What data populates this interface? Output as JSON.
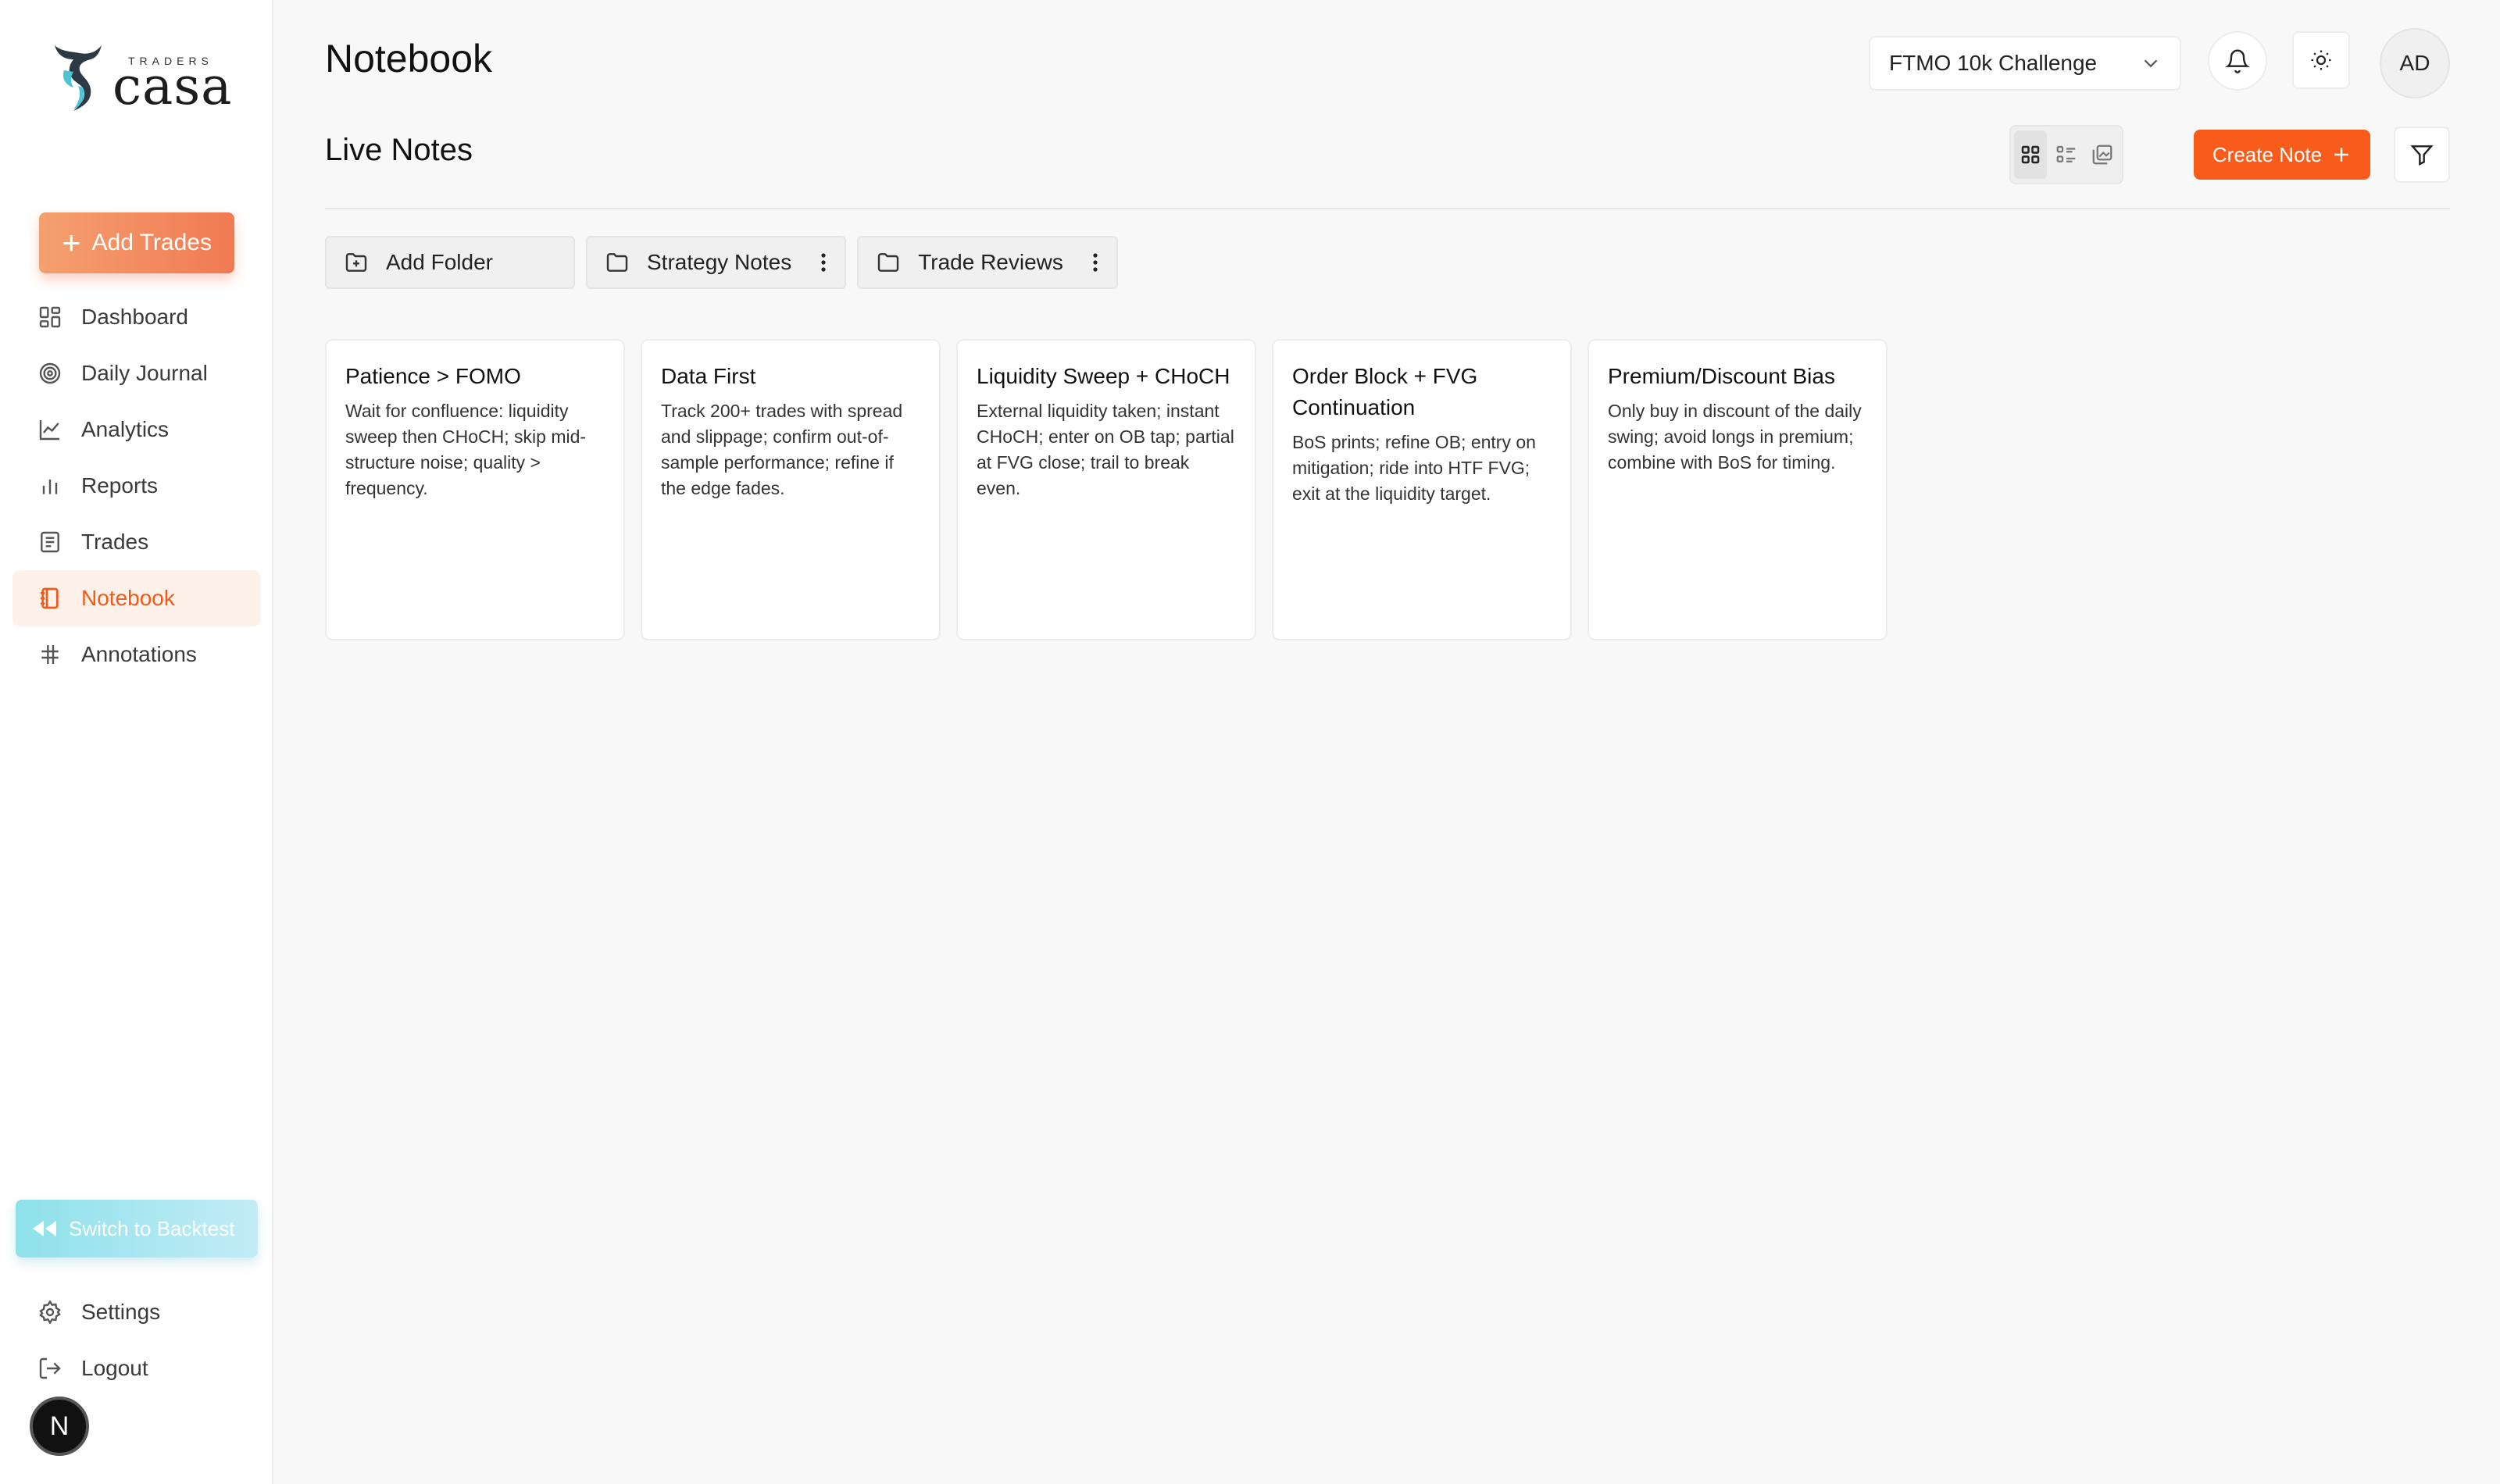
{
  "brand": {
    "small": "TRADERS",
    "big": "casa"
  },
  "sidebar": {
    "add_trades_label": "Add Trades",
    "items": [
      {
        "label": "Dashboard",
        "icon": "dashboard-icon"
      },
      {
        "label": "Daily Journal",
        "icon": "target-icon"
      },
      {
        "label": "Analytics",
        "icon": "line-chart-icon"
      },
      {
        "label": "Reports",
        "icon": "bar-chart-icon"
      },
      {
        "label": "Trades",
        "icon": "list-icon"
      },
      {
        "label": "Notebook",
        "icon": "notebook-icon",
        "active": true
      },
      {
        "label": "Annotations",
        "icon": "hash-icon"
      }
    ],
    "switch_label": "Switch to Backtest",
    "bottom_items": [
      {
        "label": "Settings",
        "icon": "gear-icon"
      },
      {
        "label": "Logout",
        "icon": "logout-icon"
      }
    ],
    "n_badge": "N"
  },
  "header": {
    "title": "Notebook",
    "account_select": "FTMO 10k Challenge",
    "avatar_initials": "AD"
  },
  "toolbar": {
    "section_title": "Live Notes",
    "create_note_label": "Create Note"
  },
  "folders": [
    {
      "label": "Add Folder",
      "icon": "folder-plus-icon",
      "menu": false
    },
    {
      "label": "Strategy Notes",
      "icon": "folder-icon",
      "menu": true
    },
    {
      "label": "Trade Reviews",
      "icon": "folder-icon",
      "menu": true
    }
  ],
  "notes": [
    {
      "title": "Patience > FOMO",
      "body": "Wait for confluence: liquidity sweep then CHoCH; skip mid-structure noise; quality > frequency."
    },
    {
      "title": "Data First",
      "body": "Track 200+ trades with spread and slippage; confirm out-of-sample performance; refine if the edge fades."
    },
    {
      "title": "Liquidity Sweep + CHoCH",
      "body": "External liquidity taken; instant CHoCH; enter on OB tap; partial at FVG close; trail to break even."
    },
    {
      "title": "Order Block + FVG Continuation",
      "body": "BoS prints; refine OB; entry on mitigation; ride into HTF FVG; exit at the liquidity target."
    },
    {
      "title": "Premium/Discount Bias",
      "body": "Only buy in discount of the daily swing; avoid longs in premium; combine with BoS for timing."
    }
  ],
  "colors": {
    "accent": "#f95c1a",
    "active_bg": "#fdf1ea",
    "backtest": "#8ee1ea"
  }
}
